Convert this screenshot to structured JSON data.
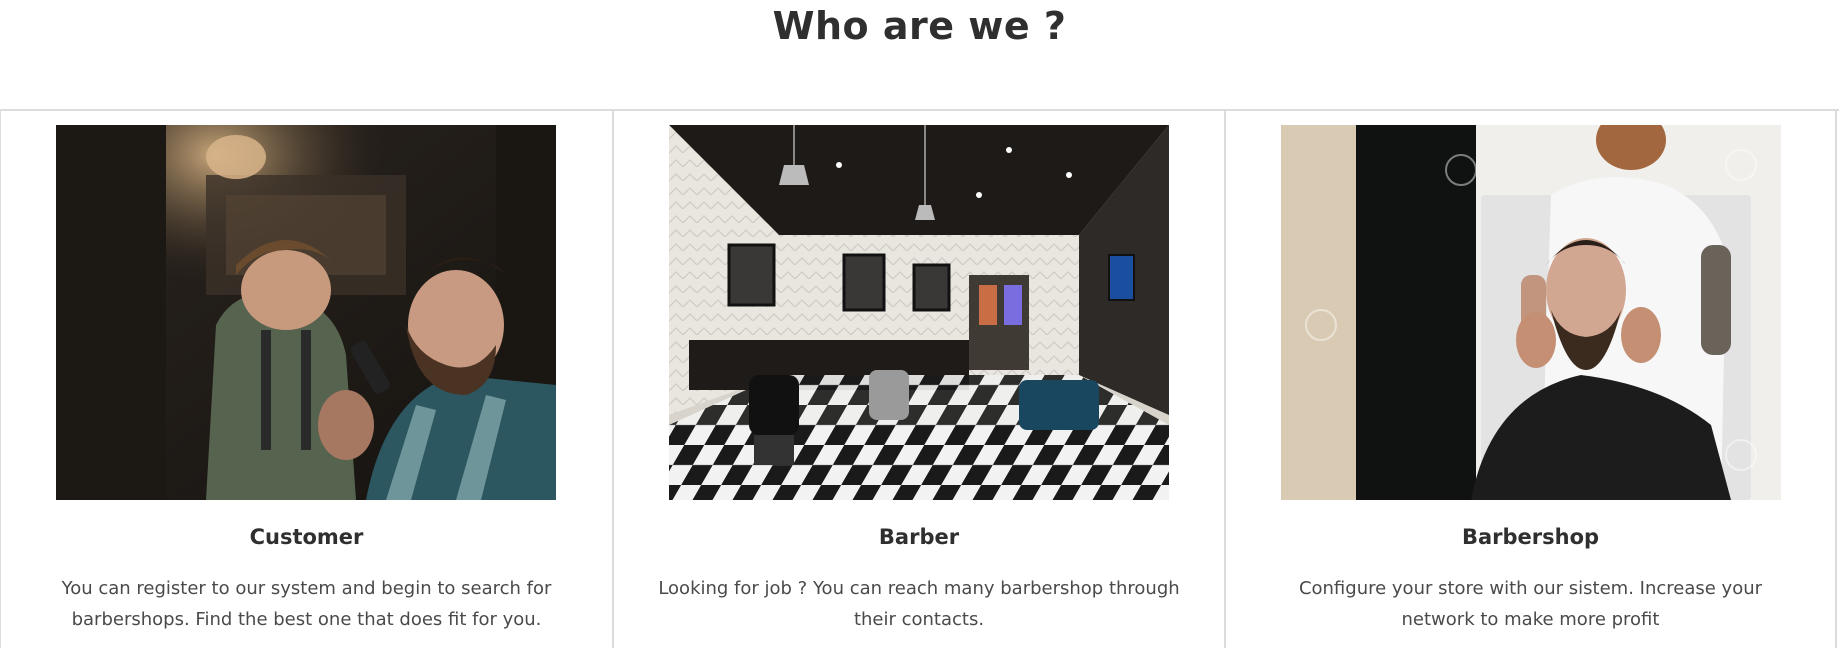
{
  "section": {
    "title": "Who are we ?"
  },
  "cards": [
    {
      "title": "Customer",
      "text": "You can register to our system and begin to search for barbershops. Find the best one that does fit for you.",
      "image_alt": "barber-trimming-beard-photo"
    },
    {
      "title": "Barber",
      "text": "Looking for job ? You can reach many barbershop through their contacts.",
      "image_alt": "barbershop-interior-photo"
    },
    {
      "title": "Barbershop",
      "text": "Configure your store with our sistem. Increase your network to make more profit",
      "image_alt": "barber-holding-client-photo"
    }
  ],
  "colors": {
    "border": "#dcdcdc",
    "title": "#2f2f2f",
    "text": "#4a4a4a"
  }
}
